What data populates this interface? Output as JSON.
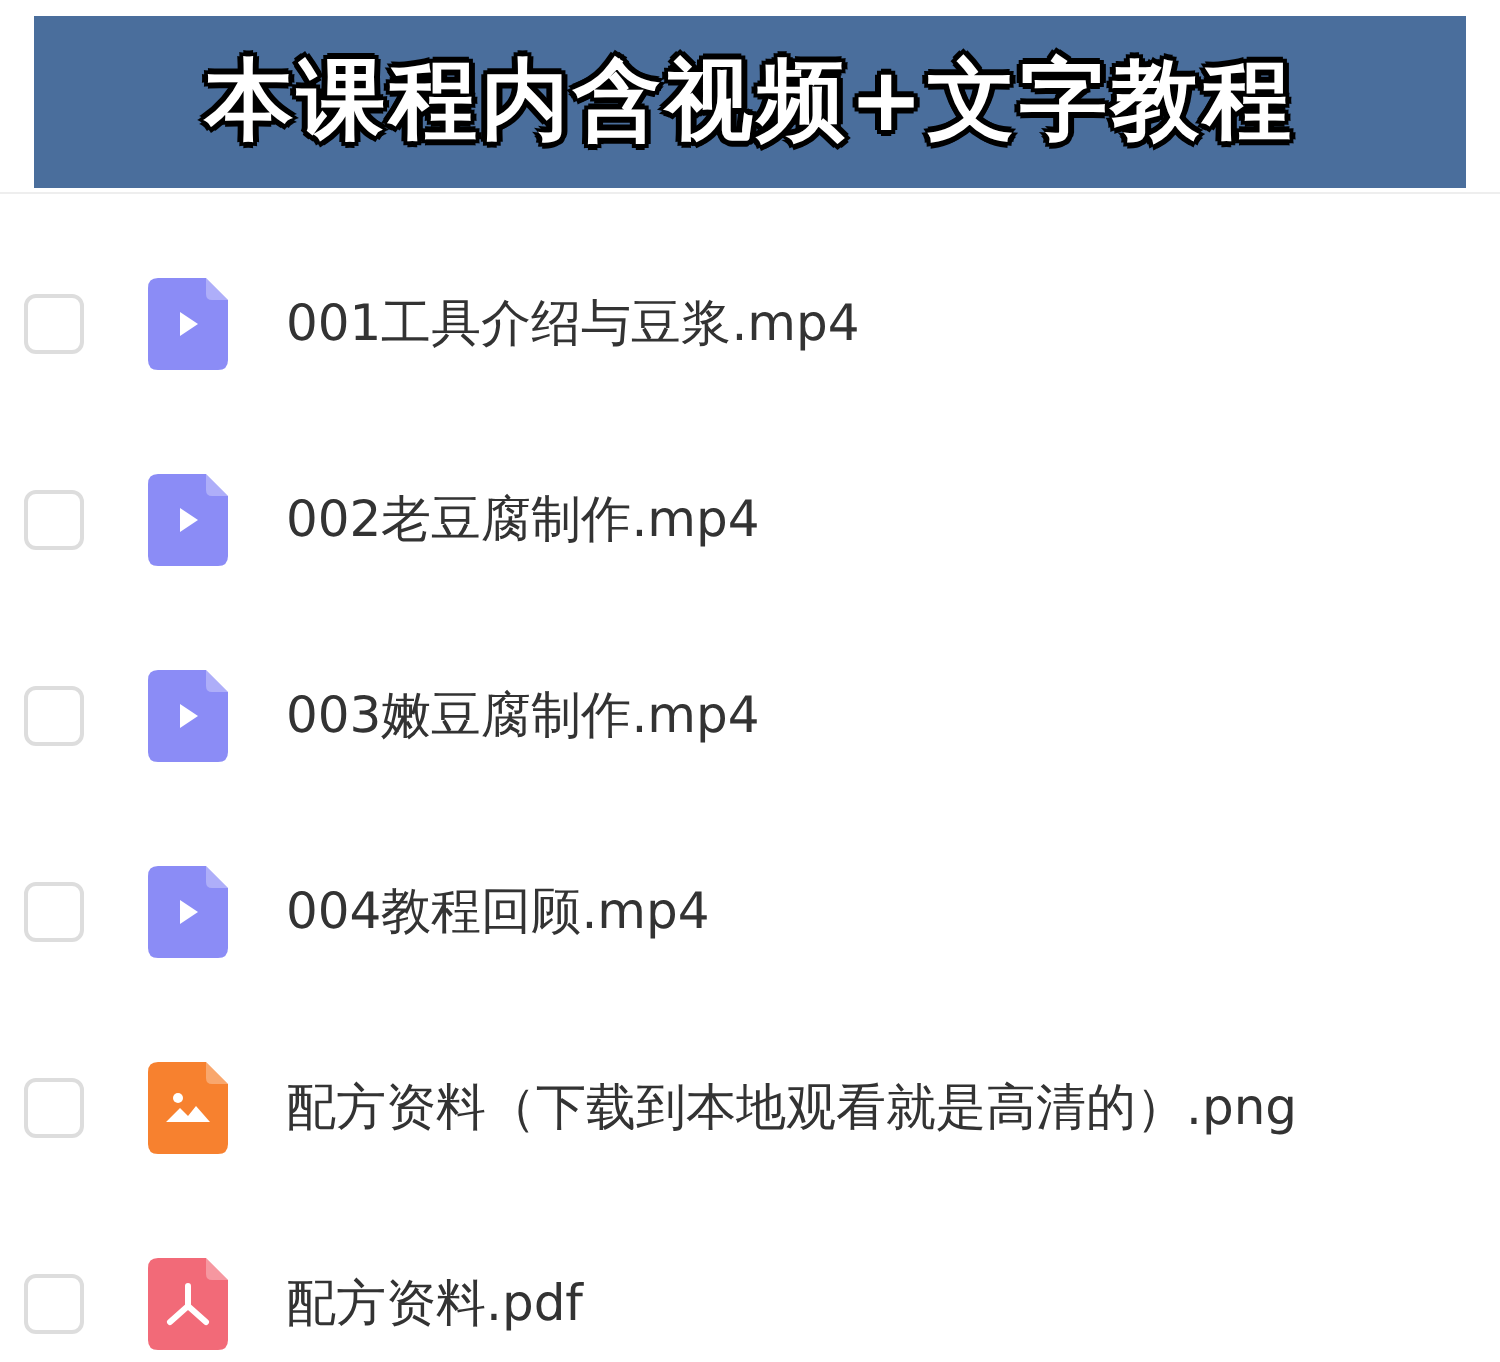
{
  "banner": {
    "title": "本课程内含视频+文字教程"
  },
  "files": [
    {
      "name": "001工具介绍与豆浆.mp4",
      "kind": "video",
      "checked": false
    },
    {
      "name": "002老豆腐制作.mp4",
      "kind": "video",
      "checked": false
    },
    {
      "name": "003嫩豆腐制作.mp4",
      "kind": "video",
      "checked": false
    },
    {
      "name": "004教程回顾.mp4",
      "kind": "video",
      "checked": false
    },
    {
      "name": "配方资料（下载到本地观看就是高清的）.png",
      "kind": "image",
      "checked": false
    },
    {
      "name": "配方资料.pdf",
      "kind": "pdf",
      "checked": false
    }
  ]
}
